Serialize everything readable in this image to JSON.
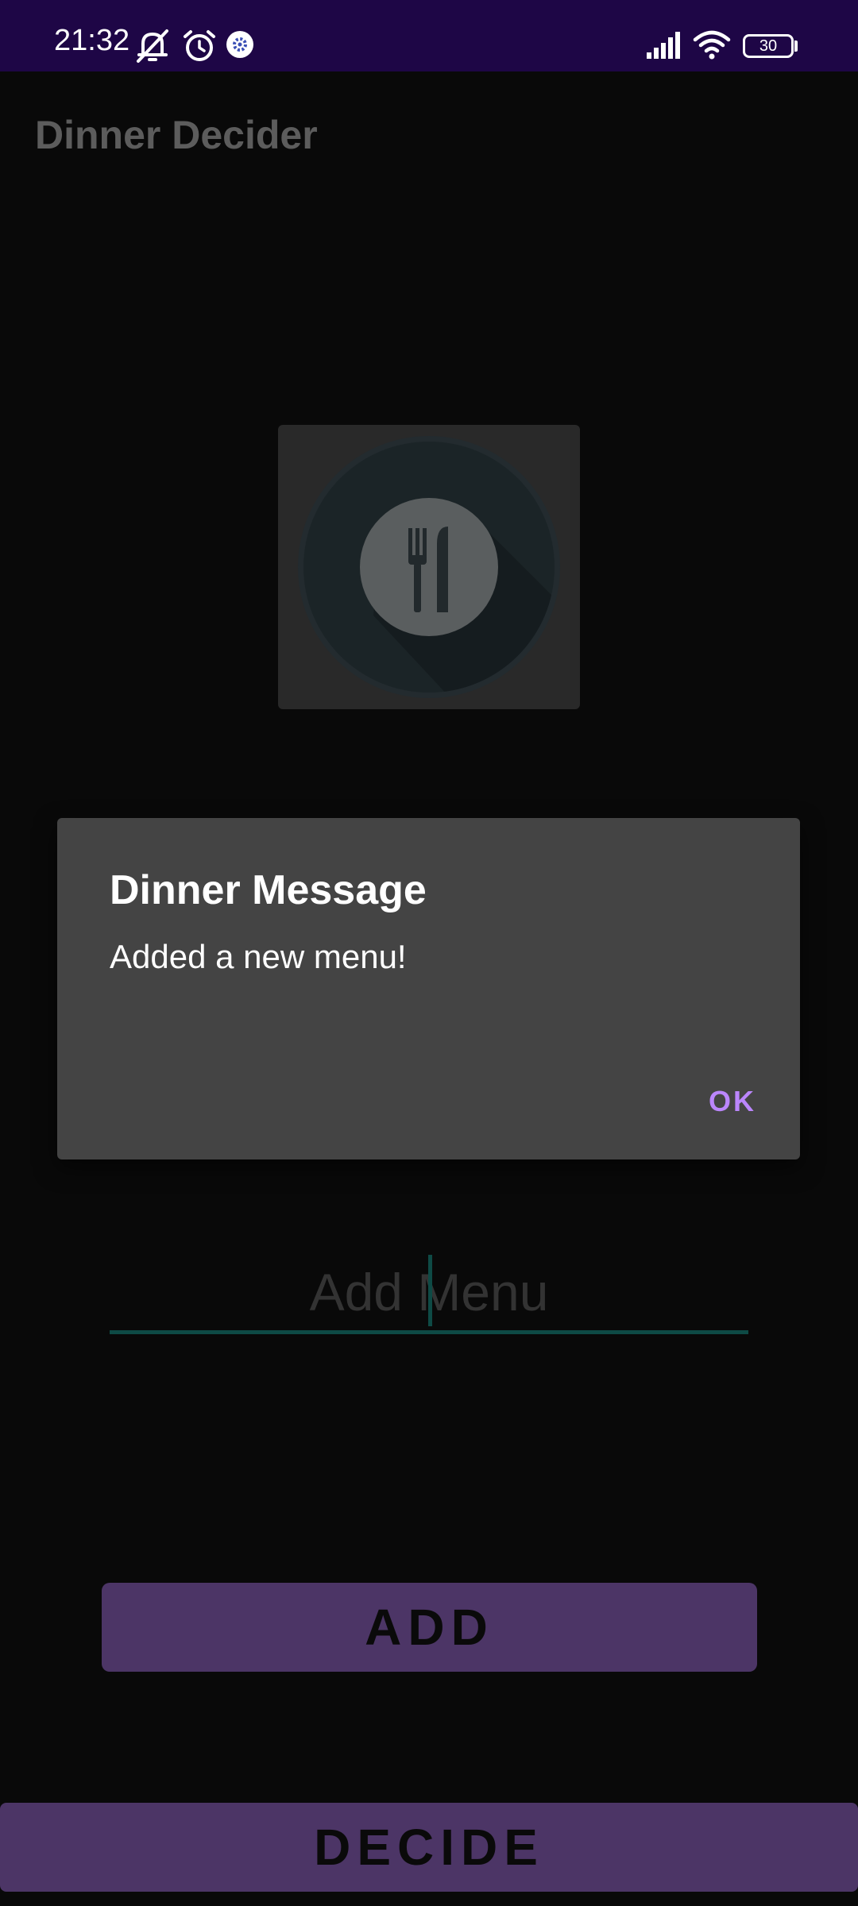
{
  "status_bar": {
    "time": "21:32",
    "icons": [
      "notifications-muted-icon",
      "alarm-icon",
      "gear-app-icon",
      "signal-icon",
      "wifi-icon"
    ],
    "battery": "30",
    "background": "#1e0646"
  },
  "app": {
    "title": "Dinner Decider",
    "logo_icon": "fork-knife-plate-icon",
    "add_input": {
      "placeholder": "Add Menu",
      "value": ""
    },
    "add_button": "ADD",
    "decide_button": "DECIDE",
    "button_color": "#4c3566",
    "input_underline_color": "#0e4a45"
  },
  "dialog": {
    "title": "Dinner Message",
    "message": "Added a new menu!",
    "ok_button": "OK",
    "background": "#444444",
    "accent_color": "#bb86fc"
  }
}
